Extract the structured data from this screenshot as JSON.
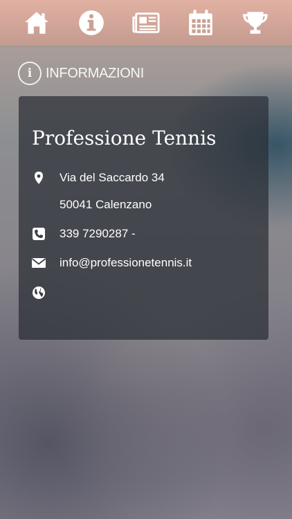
{
  "nav": {
    "items": [
      {
        "icon": "home-icon"
      },
      {
        "icon": "info-icon"
      },
      {
        "icon": "news-icon"
      },
      {
        "icon": "calendar-icon"
      },
      {
        "icon": "trophy-icon"
      }
    ],
    "color": "#ffffff"
  },
  "section": {
    "icon_letter": "i",
    "title": "INFORMAZIONI"
  },
  "club": {
    "name": "Professione Tennis",
    "address_line1": "Via del Saccardo 34",
    "address_line2": "50041 Calenzano",
    "phone": "339 7290287 -",
    "email": "info@professionetennis.it",
    "website": ""
  }
}
